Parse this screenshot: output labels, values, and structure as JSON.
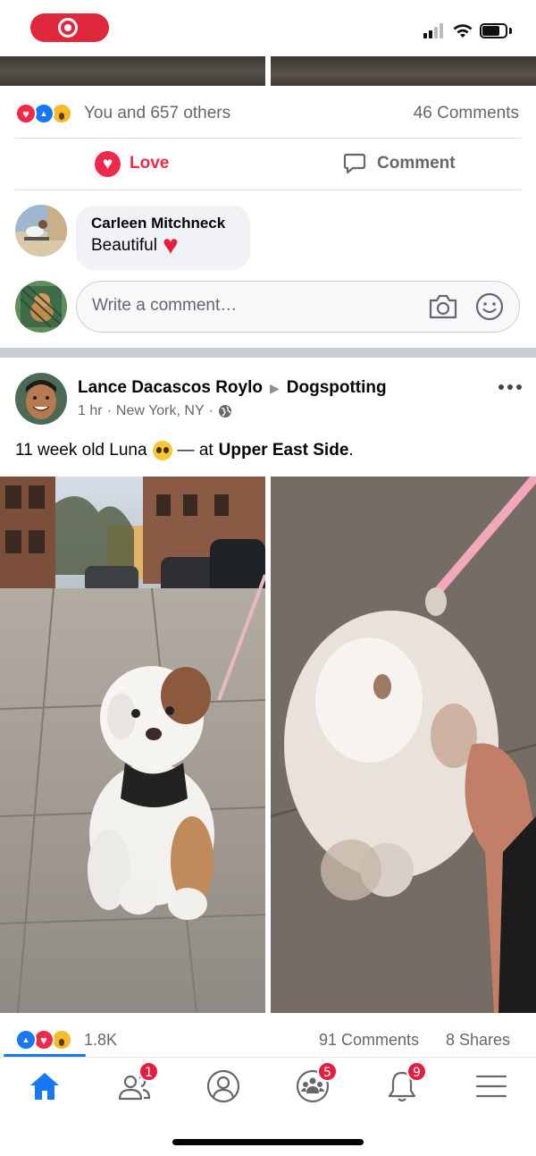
{
  "status_bar": {
    "recording": true
  },
  "prev_post": {
    "reactions_text": "You and 657 others",
    "comments_count": "46 Comments",
    "actions": {
      "love_label": "Love",
      "comment_label": "Comment"
    },
    "comment": {
      "author": "Carleen Mitchneck",
      "text": "Beautiful"
    },
    "write_comment_placeholder": "Write a comment…"
  },
  "post": {
    "author": "Lance Dacascos Roylo",
    "group": "Dogspotting",
    "time": "1 hr",
    "location": "New York, NY",
    "caption_prefix": "11 week old Luna",
    "caption_mid": "— at",
    "caption_place": "Upper East Side",
    "caption_suffix": ".",
    "reaction_count": "1.8K",
    "comments_count": "91 Comments",
    "shares_count": "8 Shares"
  },
  "tabbar": {
    "tabs": [
      {
        "name": "home",
        "icon": "home-icon",
        "badge": null,
        "active": true
      },
      {
        "name": "friends",
        "icon": "friends-icon",
        "badge": "1",
        "active": false
      },
      {
        "name": "profile",
        "icon": "profile-icon",
        "badge": null,
        "active": false
      },
      {
        "name": "groups",
        "icon": "groups-icon",
        "badge": "5",
        "active": false
      },
      {
        "name": "notifications",
        "icon": "bell-icon",
        "badge": "9",
        "active": false
      },
      {
        "name": "menu",
        "icon": "menu-icon",
        "badge": null,
        "active": false
      }
    ]
  },
  "colors": {
    "brand_blue": "#1877f2",
    "love_red": "#f0284a",
    "badge_red": "#e41e3f",
    "muted_text": "#65676b"
  }
}
